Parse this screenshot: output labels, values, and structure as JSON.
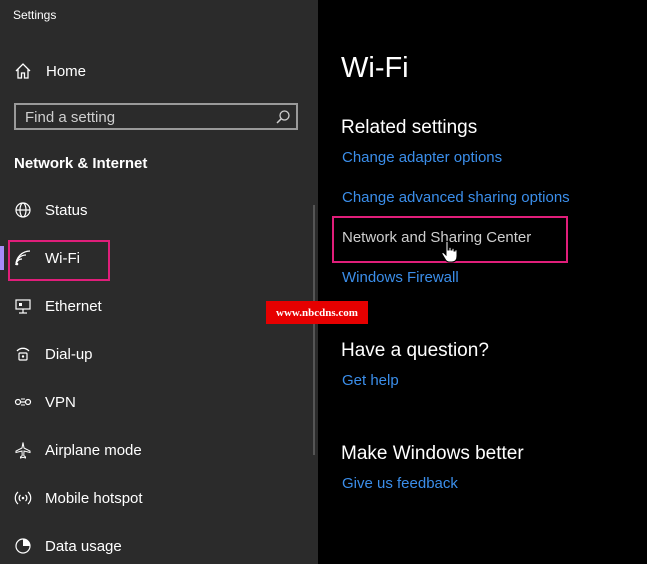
{
  "window": {
    "title": "Settings"
  },
  "sidebar": {
    "home_label": "Home",
    "search_placeholder": "Find a setting",
    "section_title": "Network & Internet",
    "items": [
      {
        "label": "Status",
        "icon": "globe-icon"
      },
      {
        "label": "Wi-Fi",
        "icon": "wifi-icon",
        "active": true
      },
      {
        "label": "Ethernet",
        "icon": "ethernet-icon"
      },
      {
        "label": "Dial-up",
        "icon": "dialup-icon"
      },
      {
        "label": "VPN",
        "icon": "vpn-icon"
      },
      {
        "label": "Airplane mode",
        "icon": "airplane-icon"
      },
      {
        "label": "Mobile hotspot",
        "icon": "hotspot-icon"
      },
      {
        "label": "Data usage",
        "icon": "data-usage-icon"
      }
    ]
  },
  "main": {
    "title": "Wi-Fi",
    "related_heading": "Related settings",
    "related_links": [
      "Change adapter options",
      "Change advanced sharing options",
      "Network and Sharing Center",
      "Windows Firewall"
    ],
    "question_heading": "Have a question?",
    "question_link": "Get help",
    "better_heading": "Make Windows better",
    "better_link": "Give us feedback"
  },
  "watermark": "www.nbcdns.com",
  "colors": {
    "accent": "#a78bfa",
    "link": "#3b8eea",
    "highlight": "#e01e7a",
    "sidebar_bg": "#2b2b2b"
  }
}
